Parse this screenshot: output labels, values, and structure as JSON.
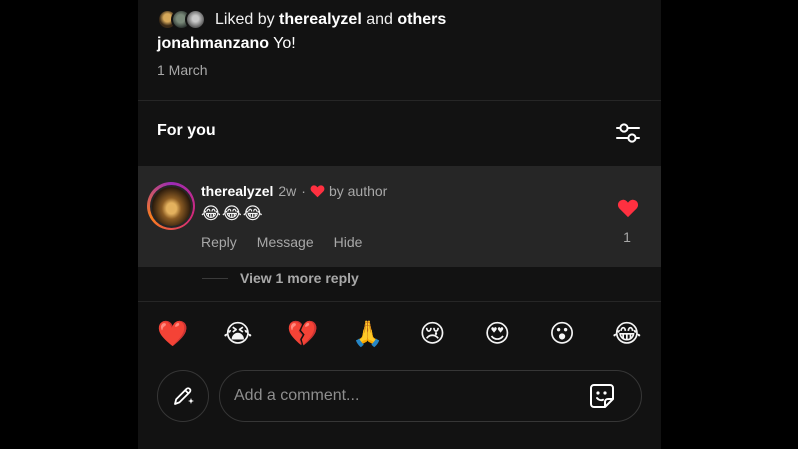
{
  "post": {
    "liked_by_prefix": "Liked by",
    "liked_by_user": "therealyzel",
    "liked_by_and": "and",
    "liked_by_others": "others",
    "caption_user": "jonahmanzano",
    "caption_text": "Yo!",
    "date": "1 March"
  },
  "section": {
    "title": "For you",
    "filter_icon": "sliders-icon"
  },
  "comment": {
    "username": "therealyzel",
    "time": "2w",
    "separator": "·",
    "liked_by_author": "by author",
    "text": "😂😂😂",
    "actions": {
      "reply": "Reply",
      "message": "Message",
      "hide": "Hide"
    },
    "like_count": "1",
    "accent_color": "#ff3040"
  },
  "replies": {
    "view_more": "View 1 more reply"
  },
  "emoji_bar": [
    "❤️",
    "😭",
    "💔",
    "🙏",
    "😢",
    "😍",
    "😮",
    "😂"
  ],
  "composer": {
    "placeholder": "Add a comment...",
    "pen_icon": "pen-sparkle-icon",
    "sticker_icon": "sticker-icon"
  }
}
